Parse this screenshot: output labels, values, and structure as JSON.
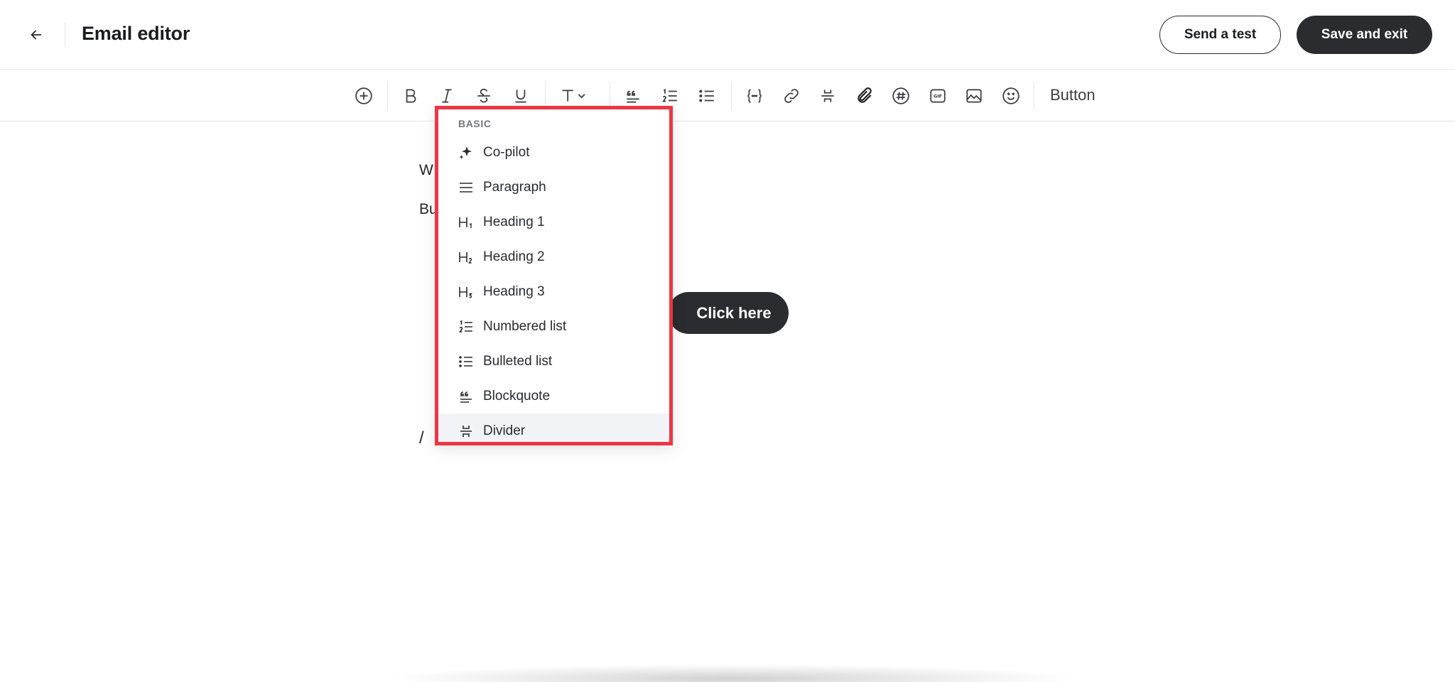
{
  "header": {
    "back_icon": "arrow-left-icon",
    "title": "Email editor",
    "send_test_label": "Send a test",
    "save_exit_label": "Save and exit"
  },
  "toolbar": {
    "icons": [
      "add-circle-icon",
      "bold-icon",
      "italic-icon",
      "strikethrough-icon",
      "underline-icon",
      "text-style-icon",
      "blockquote-icon",
      "numbered-list-icon",
      "bulleted-list-icon",
      "variable-braces-icon",
      "link-icon",
      "divider-icon",
      "attachment-icon",
      "hashtag-icon",
      "gif-icon",
      "image-icon",
      "emoji-icon"
    ],
    "button_label": "Button"
  },
  "editor": {
    "line1_visible": "W",
    "line2_visible": "Bu",
    "line3_visible": "/",
    "cta_label": "Click here"
  },
  "dropdown": {
    "section_label": "BASIC",
    "items": [
      {
        "label": "Co-pilot",
        "icon": "sparkle-icon"
      },
      {
        "label": "Paragraph",
        "icon": "paragraph-icon"
      },
      {
        "label": "Heading 1",
        "icon": "heading-1-icon"
      },
      {
        "label": "Heading 2",
        "icon": "heading-2-icon"
      },
      {
        "label": "Heading 3",
        "icon": "heading-3-icon"
      },
      {
        "label": "Numbered list",
        "icon": "numbered-list-icon"
      },
      {
        "label": "Bulleted list",
        "icon": "bulleted-list-icon"
      },
      {
        "label": "Blockquote",
        "icon": "blockquote-icon"
      },
      {
        "label": "Divider",
        "icon": "divider-icon"
      }
    ],
    "highlight_color": "#ee3545"
  }
}
